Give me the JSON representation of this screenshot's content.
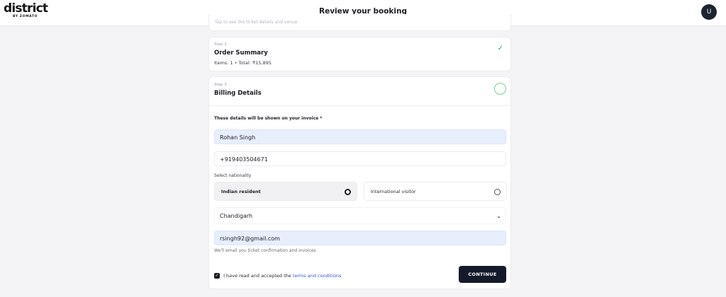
{
  "header": {
    "logo_text": "district",
    "logo_sub": "BY ZOMATO",
    "title": "Review your booking",
    "avatar_initial": "U"
  },
  "steps": {
    "step1": {
      "hint_cut": "Tap to see the ticket details and venue"
    },
    "step2": {
      "label": "Step 2",
      "title": "Order Summary",
      "summary": "Items: 1 • Total: ₹15,895",
      "status": "completed"
    },
    "step3": {
      "label": "Step 3",
      "title": "Billing Details",
      "status": "in-progress"
    }
  },
  "billing": {
    "section_note": "These details will be shown on your invoice *",
    "name_value": "Rohan Singh",
    "phone_value": "+919403504671",
    "nationality_label": "Select nationality",
    "nationality_options": [
      {
        "label": "Indian resident",
        "selected": true
      },
      {
        "label": "International visitor",
        "selected": false
      }
    ],
    "state_value": "Chandigarh",
    "email_value": "rsingh92@gmail.com",
    "email_help": "We'll email you ticket confirmation and invoices",
    "consent_text": "I have read and accepted the",
    "terms_link": "terms and conditions",
    "consent_checked": true,
    "continue_label": "CONTINUE"
  },
  "colors": {
    "accent_dark": "#141a2a",
    "success_green": "#2aa56a",
    "filled_input": "#e7eefc",
    "link_blue": "#3a55c8"
  }
}
